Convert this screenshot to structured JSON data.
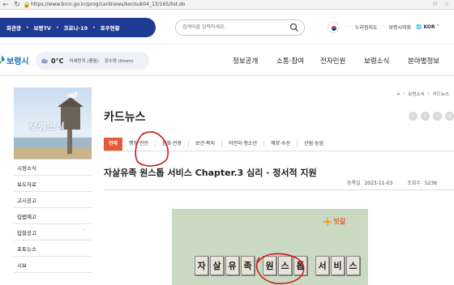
{
  "browser": {
    "url": "https://www.brcn.go.kr/prog/cardnews/kor/sub04_13/165/list.do"
  },
  "util": {
    "links": [
      "화관광",
      "보령TV",
      "코로나-19",
      "호우현황"
    ],
    "search_placeholder": "검색어를 입력하세요.",
    "right_links": [
      "누리집지도",
      "보령시의회"
    ],
    "lang": "KOR"
  },
  "nav": {
    "logo_text": "보령시",
    "weather_temp": "0°C",
    "weather_air": "미세먼지 (좋음)",
    "weather_rain": "강수량 (0mm)",
    "menu": [
      "정보공개",
      "소통·참여",
      "전자민원",
      "보령소식",
      "분야별정보"
    ]
  },
  "sidebar": {
    "banner_title": "보령소식",
    "items": [
      "시정소식",
      "보도자료",
      "고시공고",
      "입법예고",
      "입찰공고",
      "포토뉴스",
      "시보"
    ]
  },
  "content": {
    "breadcrumb": [
      "보령소식",
      "카드뉴스"
    ],
    "page_title": "카드뉴스",
    "tabs": [
      "전체",
      "행정·안전",
      "문화·관광",
      "보건·복지",
      "어린이·청소년",
      "해양·수산",
      "산림·농업"
    ],
    "article_title": "자살유족 원스톱 서비스 Chapter.3 심리 · 정서적 지원",
    "meta_date_label": "등록일",
    "meta_date": "2023-11-03",
    "meta_views_label": "조회수",
    "meta_views": "5236",
    "card_brand": "잇길",
    "card_tiles": [
      "자",
      "살",
      "유",
      "족",
      "원",
      "스",
      "톱",
      "서",
      "비",
      "스"
    ]
  },
  "colors": {
    "util_bar": "#1f3a93",
    "logo_blue": "#1e6fbf",
    "tab_active": "#e25a38",
    "annotation_red": "#d01818"
  }
}
